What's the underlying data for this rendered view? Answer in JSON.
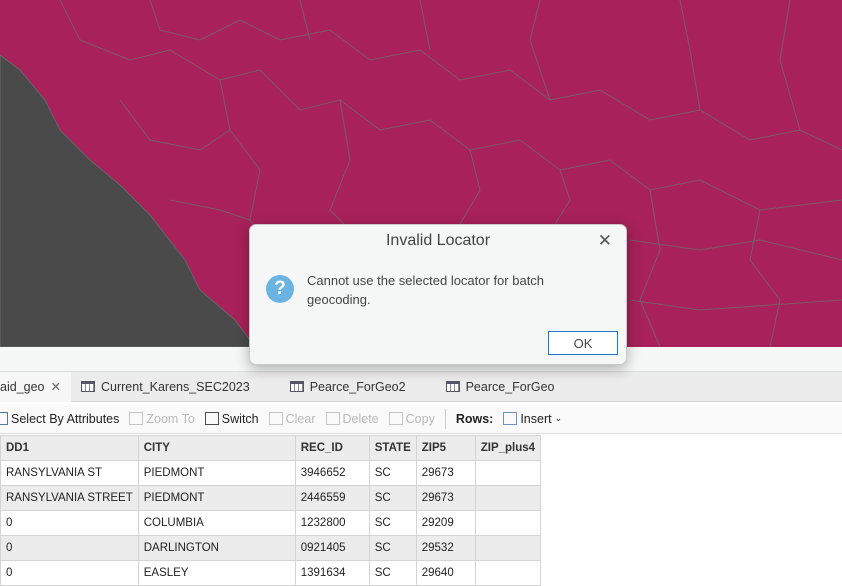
{
  "map": {
    "fill_color": "#a8215a",
    "basemap_color": "#4a4a4a"
  },
  "tabs": [
    {
      "label": "aid_geo",
      "active": true
    },
    {
      "label": "Current_Karens_SEC2023"
    },
    {
      "label": "Pearce_ForGeo2"
    },
    {
      "label": "Pearce_ForGeo"
    }
  ],
  "toolbar": {
    "select_by_attributes": "Select By Attributes",
    "zoom_to": "Zoom To",
    "switch": "Switch",
    "clear": "Clear",
    "delete": "Delete",
    "copy": "Copy",
    "rows_label": "Rows:",
    "insert": "Insert"
  },
  "table": {
    "headers": [
      "DD1",
      "CITY",
      "REC_ID",
      "STATE",
      "ZIP5",
      "ZIP_plus4"
    ],
    "rows": [
      [
        "RANSYLVANIA ST",
        "PIEDMONT",
        "3946652",
        "SC",
        "29673",
        ""
      ],
      [
        "RANSYLVANIA STREET",
        "PIEDMONT",
        "2446559",
        "SC",
        "29673",
        ""
      ],
      [
        "0",
        "COLUMBIA",
        "1232800",
        "SC",
        "29209",
        ""
      ],
      [
        "0",
        "DARLINGTON",
        "0921405",
        "SC",
        "29532",
        ""
      ],
      [
        "0",
        "EASLEY",
        "1391634",
        "SC",
        "29640",
        ""
      ]
    ]
  },
  "dialog": {
    "title": "Invalid Locator",
    "message": "Cannot use the selected locator for batch geocoding.",
    "ok": "OK"
  }
}
